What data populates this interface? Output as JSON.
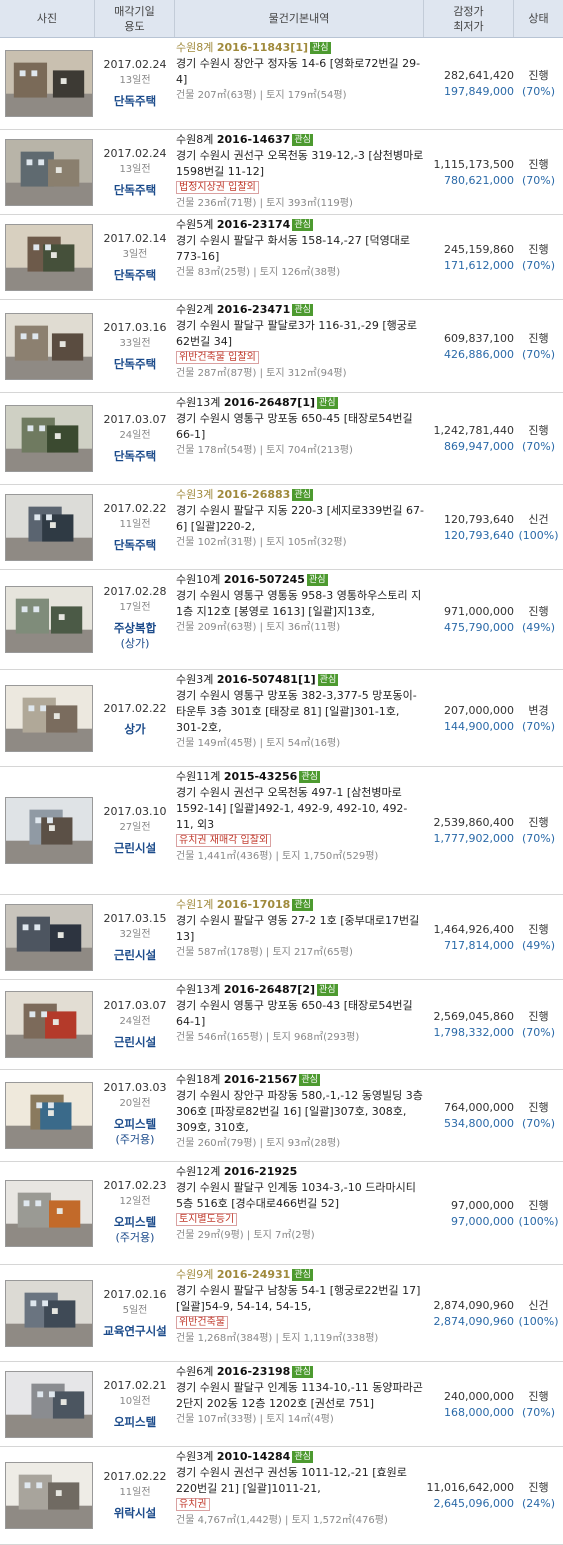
{
  "header": {
    "photo": "사진",
    "date_line1": "매각기일",
    "date_line2": "용도",
    "info": "물건기본내역",
    "price_line1": "감정가",
    "price_line2": "최저가",
    "status": "상태"
  },
  "colors": {
    "header_bg": "#dfe6f0",
    "accent_blue": "#1a4a8a",
    "price_blue": "#2b6aa8",
    "tag_red": "#c0392b",
    "star_green": "#4d9a30"
  },
  "rows": [
    {
      "date": "2017.02.24",
      "days": "13일전",
      "type": "단독주택",
      "type2": "",
      "court": "수원8계",
      "case": "2016-11843[1]",
      "star": "관심",
      "muted": true,
      "addr": "경기 수원시 장안구 정자동 14-6 [영화로72번길 29-4]",
      "tags": "",
      "area": "건물 207㎡(63평) | 토지 179㎡(54평)",
      "appraisal": "282,641,420",
      "min": "197,849,000",
      "status": "진행",
      "pct": "(70%)"
    },
    {
      "date": "2017.02.24",
      "days": "13일전",
      "type": "단독주택",
      "type2": "",
      "court": "수원8계",
      "case": "2016-14637",
      "star": "관심",
      "muted": false,
      "addr": "경기 수원시 권선구 오목천동 319-12,-3 [삼천병마로1598번길 11-12]",
      "tags": "법정지상권 입찰외",
      "area": "건물 236㎡(71평) | 토지 393㎡(119평)",
      "appraisal": "1,115,173,500",
      "min": "780,621,000",
      "status": "진행",
      "pct": "(70%)"
    },
    {
      "date": "2017.02.14",
      "days": "3일전",
      "type": "단독주택",
      "type2": "",
      "court": "수원5계",
      "case": "2016-23174",
      "star": "관심",
      "muted": false,
      "addr": "경기 수원시 팔달구 화서동 158-14,-27 [덕영대로 773-16]",
      "tags": "",
      "area": "건물 83㎡(25평) | 토지 126㎡(38평)",
      "appraisal": "245,159,860",
      "min": "171,612,000",
      "status": "진행",
      "pct": "(70%)"
    },
    {
      "date": "2017.03.16",
      "days": "33일전",
      "type": "단독주택",
      "type2": "",
      "court": "수원2계",
      "case": "2016-23471",
      "star": "관심",
      "muted": false,
      "addr": "경기 수원시 팔달구 팔달로3가 116-31,-29 [행궁로62번길 34]",
      "tags": "위반건축물 입찰외",
      "area": "건물 287㎡(87평) | 토지 312㎡(94평)",
      "appraisal": "609,837,100",
      "min": "426,886,000",
      "status": "진행",
      "pct": "(70%)"
    },
    {
      "date": "2017.03.07",
      "days": "24일전",
      "type": "단독주택",
      "type2": "",
      "court": "수원13계",
      "case": "2016-26487[1]",
      "star": "관심",
      "muted": false,
      "addr": "경기 수원시 영통구 망포동 650-45 [태장로54번길 66-1]",
      "tags": "",
      "area": "건물 178㎡(54평) | 토지 704㎡(213평)",
      "appraisal": "1,242,781,440",
      "min": "869,947,000",
      "status": "진행",
      "pct": "(70%)"
    },
    {
      "date": "2017.02.22",
      "days": "11일전",
      "type": "단독주택",
      "type2": "",
      "court": "수원3계",
      "case": "2016-26883",
      "star": "관심",
      "muted": true,
      "addr": "경기 수원시 팔달구 지동 220-3 [세지로339번길 67-6] [일괄]220-2,",
      "tags": "",
      "area": "건물 102㎡(31평) | 토지 105㎡(32평)",
      "appraisal": "120,793,640",
      "min": "120,793,640",
      "status": "신건",
      "pct": "(100%)"
    },
    {
      "date": "2017.02.28",
      "days": "17일전",
      "type": "주상복합",
      "type2": "(상가)",
      "court": "수원10계",
      "case": "2016-507245",
      "star": "관심",
      "muted": false,
      "addr": "경기 수원시 영통구 영통동 958-3 영통하우스토리 지1층 지12호 [봉영로 1613] [일괄]지13호,",
      "tags": "",
      "area": "건물 209㎡(63평) | 토지 36㎡(11평)",
      "appraisal": "971,000,000",
      "min": "475,790,000",
      "status": "진행",
      "pct": "(49%)"
    },
    {
      "date": "2017.02.22",
      "days": "",
      "type": "상가",
      "type2": "",
      "court": "수원3계",
      "case": "2016-507481[1]",
      "star": "관심",
      "muted": false,
      "addr": "경기 수원시 영통구 망포동 382-3,377-5 망포동이-타운투 3층 301호 [태장로 81] [일괄]301-1호, 301-2호,",
      "tags": "",
      "area": "건물 149㎡(45평) | 토지 54㎡(16평)",
      "appraisal": "207,000,000",
      "min": "144,900,000",
      "status": "변경",
      "pct": "(70%)"
    },
    {
      "date": "2017.03.10",
      "days": "27일전",
      "type": "근린시설",
      "type2": "",
      "court": "수원11계",
      "case": "2015-43256",
      "star": "관심",
      "muted": false,
      "addr": "경기 수원시 권선구 오목천동 497-1 [삼천병마로 1592-14] [일괄]492-1, 492-9, 492-10, 492-11, 외3",
      "tags": "유치권 재매각 입찰외",
      "area": "건물 1,441㎡(436평) | 토지 1,750㎡(529평)",
      "appraisal": "2,539,860,400",
      "min": "1,777,902,000",
      "status": "진행",
      "pct": "(70%)"
    },
    {
      "date": "2017.03.15",
      "days": "32일전",
      "type": "근린시설",
      "type2": "",
      "court": "수원1계",
      "case": "2016-17018",
      "star": "관심",
      "muted": true,
      "addr": "경기 수원시 팔달구 영동 27-2 1호 [중부대로17번길 13]",
      "tags": "",
      "area": "건물 587㎡(178평) | 토지 217㎡(65평)",
      "appraisal": "1,464,926,400",
      "min": "717,814,000",
      "status": "진행",
      "pct": "(49%)"
    },
    {
      "date": "2017.03.07",
      "days": "24일전",
      "type": "근린시설",
      "type2": "",
      "court": "수원13계",
      "case": "2016-26487[2]",
      "star": "관심",
      "muted": false,
      "addr": "경기 수원시 영통구 망포동 650-43 [태장로54번길 64-1]",
      "tags": "",
      "area": "건물 546㎡(165평) | 토지 968㎡(293평)",
      "appraisal": "2,569,045,860",
      "min": "1,798,332,000",
      "status": "진행",
      "pct": "(70%)"
    },
    {
      "date": "2017.03.03",
      "days": "20일전",
      "type": "오피스텔",
      "type2": "(주거용)",
      "court": "수원18계",
      "case": "2016-21567",
      "star": "관심",
      "muted": false,
      "addr": "경기 수원시 장안구 파장동 580,-1,-12 동영빌딩 3층 306호 [파장로82번길 16] [일괄]307호, 308호, 309호, 310호,",
      "tags": "",
      "area": "건물 260㎡(79평) | 토지 93㎡(28평)",
      "appraisal": "764,000,000",
      "min": "534,800,000",
      "status": "진행",
      "pct": "(70%)"
    },
    {
      "date": "2017.02.23",
      "days": "12일전",
      "type": "오피스텔",
      "type2": "(주거용)",
      "court": "수원12계",
      "case": "2016-21925",
      "star": "",
      "muted": false,
      "addr": "경기 수원시 팔달구 인계동 1034-3,-10 드라마시티 5층 516호 [경수대로466번길 52]",
      "tags": "토지별도등기",
      "area": "건물 29㎡(9평) | 토지 7㎡(2평)",
      "appraisal": "97,000,000",
      "min": "97,000,000",
      "status": "진행",
      "pct": "(100%)"
    },
    {
      "date": "2017.02.16",
      "days": "5일전",
      "type": "교육연구시설",
      "type2": "",
      "court": "수원9계",
      "case": "2016-24931",
      "star": "관심",
      "muted": true,
      "addr": "경기 수원시 팔달구 남창동 54-1 [행궁로22번길 17] [일괄]54-9, 54-14, 54-15,",
      "tags": "위반건축물",
      "area": "건물 1,268㎡(384평) | 토지 1,119㎡(338평)",
      "appraisal": "2,874,090,960",
      "min": "2,874,090,960",
      "status": "신건",
      "pct": "(100%)"
    },
    {
      "date": "2017.02.21",
      "days": "10일전",
      "type": "오피스텔",
      "type2": "",
      "court": "수원6계",
      "case": "2016-23198",
      "star": "관심",
      "muted": false,
      "addr": "경기 수원시 팔달구 인계동 1134-10,-11 동양파라곤2단지 202동 12층 1202호 [권선로 751]",
      "tags": "",
      "area": "건물 107㎡(33평) | 토지 14㎡(4평)",
      "appraisal": "240,000,000",
      "min": "168,000,000",
      "status": "진행",
      "pct": "(70%)"
    },
    {
      "date": "2017.02.22",
      "days": "11일전",
      "type": "위락시설",
      "type2": "",
      "court": "수원3계",
      "case": "2010-14284",
      "star": "관심",
      "muted": false,
      "addr": "경기 수원시 권선구 권선동 1011-12,-21 [효원로220번길 21] [일괄]1011-21,",
      "tags": "유치권",
      "area": "건물 4,767㎡(1,442평) | 토지 1,572㎡(476평)",
      "appraisal": "11,016,642,000",
      "min": "2,645,096,000",
      "status": "진행",
      "pct": "(24%)"
    }
  ]
}
